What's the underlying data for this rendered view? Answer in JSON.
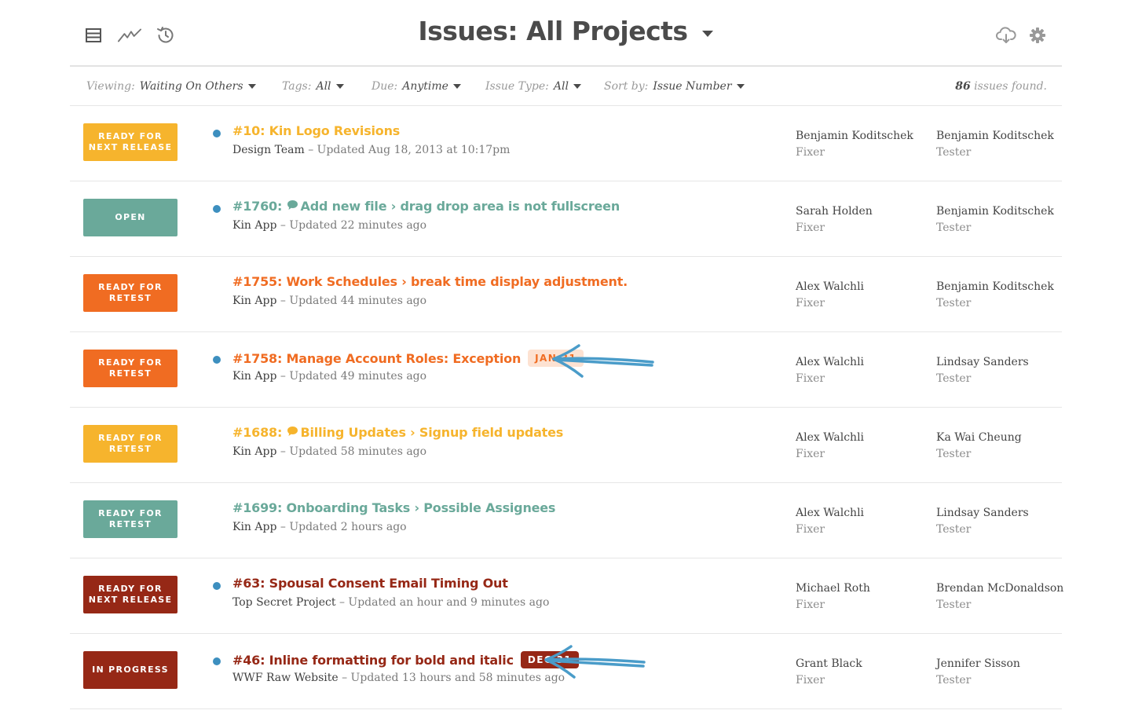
{
  "header": {
    "title": "Issues: All Projects",
    "icons": [
      "list-icon",
      "activity-icon",
      "history-icon",
      "cloud-download-icon",
      "gear-icon"
    ]
  },
  "filters": {
    "viewing": {
      "label": "Viewing:",
      "value": "Waiting On Others"
    },
    "tags": {
      "label": "Tags:",
      "value": "All"
    },
    "due": {
      "label": "Due:",
      "value": "Anytime"
    },
    "issue_type": {
      "label": "Issue Type:",
      "value": "All"
    },
    "sort_by": {
      "label": "Sort by:",
      "value": "Issue Number"
    },
    "count": "86",
    "count_suffix": "issues found."
  },
  "colors": {
    "yellow": "#f6b42d",
    "teal": "#6aa99a",
    "orange": "#f06c22",
    "darkred": "#962816",
    "dot": "#3d8fbf",
    "annotation_arrow": "#4a9cc9"
  },
  "issues": [
    {
      "status": "Ready for Next Release",
      "color": "#f6b42d",
      "unread": true,
      "comment": false,
      "number": "#10:",
      "title": "Kin Logo Revisions",
      "due": "",
      "project": "Design Team",
      "updated": " – Updated Aug 18, 2013 at 10:17pm",
      "fixer": "Benjamin Koditschek",
      "fixer_role": "Fixer",
      "tester": "Benjamin Koditschek",
      "tester_role": "Tester"
    },
    {
      "status": "Open",
      "color": "#6aa99a",
      "unread": true,
      "comment": true,
      "number": "#1760:",
      "title": "Add new file › drag drop area is not fullscreen",
      "due": "",
      "project": "Kin App",
      "updated": " – Updated 22 minutes ago",
      "fixer": "Sarah Holden",
      "fixer_role": "Fixer",
      "tester": "Benjamin Koditschek",
      "tester_role": "Tester"
    },
    {
      "status": "Ready for Retest",
      "color": "#f06c22",
      "unread": false,
      "comment": false,
      "number": "#1755:",
      "title": "Work Schedules › break time display adjustment.",
      "due": "",
      "project": "Kin App",
      "updated": " – Updated 44 minutes ago",
      "fixer": "Alex Walchli",
      "fixer_role": "Fixer",
      "tester": "Benjamin Koditschek",
      "tester_role": "Tester"
    },
    {
      "status": "Ready for Retest",
      "color": "#f06c22",
      "unread": true,
      "comment": false,
      "number": "#1758:",
      "title": "Manage Account Roles: Exception",
      "due": "Jan 31",
      "due_style": "soft",
      "project": "Kin App",
      "updated": " – Updated 49 minutes ago",
      "fixer": "Alex Walchli",
      "fixer_role": "Fixer",
      "tester": "Lindsay Sanders",
      "tester_role": "Tester"
    },
    {
      "status": "Ready for Retest",
      "color": "#f6b42d",
      "unread": false,
      "comment": true,
      "number": "#1688:",
      "title": "Billing Updates › Signup field updates",
      "due": "",
      "project": "Kin App",
      "updated": " – Updated 58 minutes ago",
      "fixer": "Alex Walchli",
      "fixer_role": "Fixer",
      "tester": "Ka Wai Cheung",
      "tester_role": "Tester"
    },
    {
      "status": "Ready for Retest",
      "color": "#6aa99a",
      "unread": false,
      "comment": false,
      "number": "#1699:",
      "title": "Onboarding Tasks › Possible Assignees",
      "due": "",
      "project": "Kin App",
      "updated": " – Updated 2 hours ago",
      "fixer": "Alex Walchli",
      "fixer_role": "Fixer",
      "tester": "Lindsay Sanders",
      "tester_role": "Tester"
    },
    {
      "status": "Ready for Next Release",
      "color": "#962816",
      "unread": true,
      "comment": false,
      "number": "#63:",
      "title": "Spousal Consent Email Timing Out",
      "due": "",
      "project": "Top Secret Project",
      "updated": " – Updated an hour and 9 minutes ago",
      "fixer": "Michael Roth",
      "fixer_role": "Fixer",
      "tester": "Brendan McDonaldson",
      "tester_role": "Tester"
    },
    {
      "status": "In Progress",
      "color": "#962816",
      "unread": true,
      "comment": false,
      "number": "#46:",
      "title": "Inline formatting for bold and italic",
      "due": "Dec 31",
      "due_style": "solid",
      "project": "WWF Raw Website",
      "updated": " – Updated 13 hours and 58 minutes ago",
      "fixer": "Grant Black",
      "fixer_role": "Fixer",
      "tester": "Jennifer Sisson",
      "tester_role": "Tester"
    }
  ]
}
